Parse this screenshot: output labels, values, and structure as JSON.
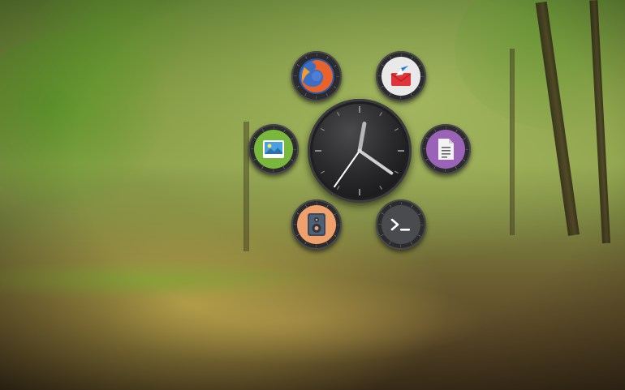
{
  "wallpaper": {
    "description_colors": {
      "sky": "#8fa34c",
      "ground": "#5c4a28"
    }
  },
  "launcher": {
    "clock": {
      "hour_hand_angle": 10,
      "minute_hand_angle": 125,
      "second_hand_angle": 215
    },
    "apps": [
      {
        "name": "firefox",
        "icon": "firefox-icon",
        "color": "#e8622c"
      },
      {
        "name": "mail",
        "icon": "mail-icon",
        "color": "#e9e9ea"
      },
      {
        "name": "images",
        "icon": "image-viewer-icon",
        "color": "#79b83d"
      },
      {
        "name": "documents",
        "icon": "document-icon",
        "color": "#9a63b8"
      },
      {
        "name": "music-player",
        "icon": "speaker-icon",
        "color": "#f0a06a"
      },
      {
        "name": "terminal",
        "icon": "terminal-icon",
        "color": "#4a4b4e"
      }
    ]
  }
}
